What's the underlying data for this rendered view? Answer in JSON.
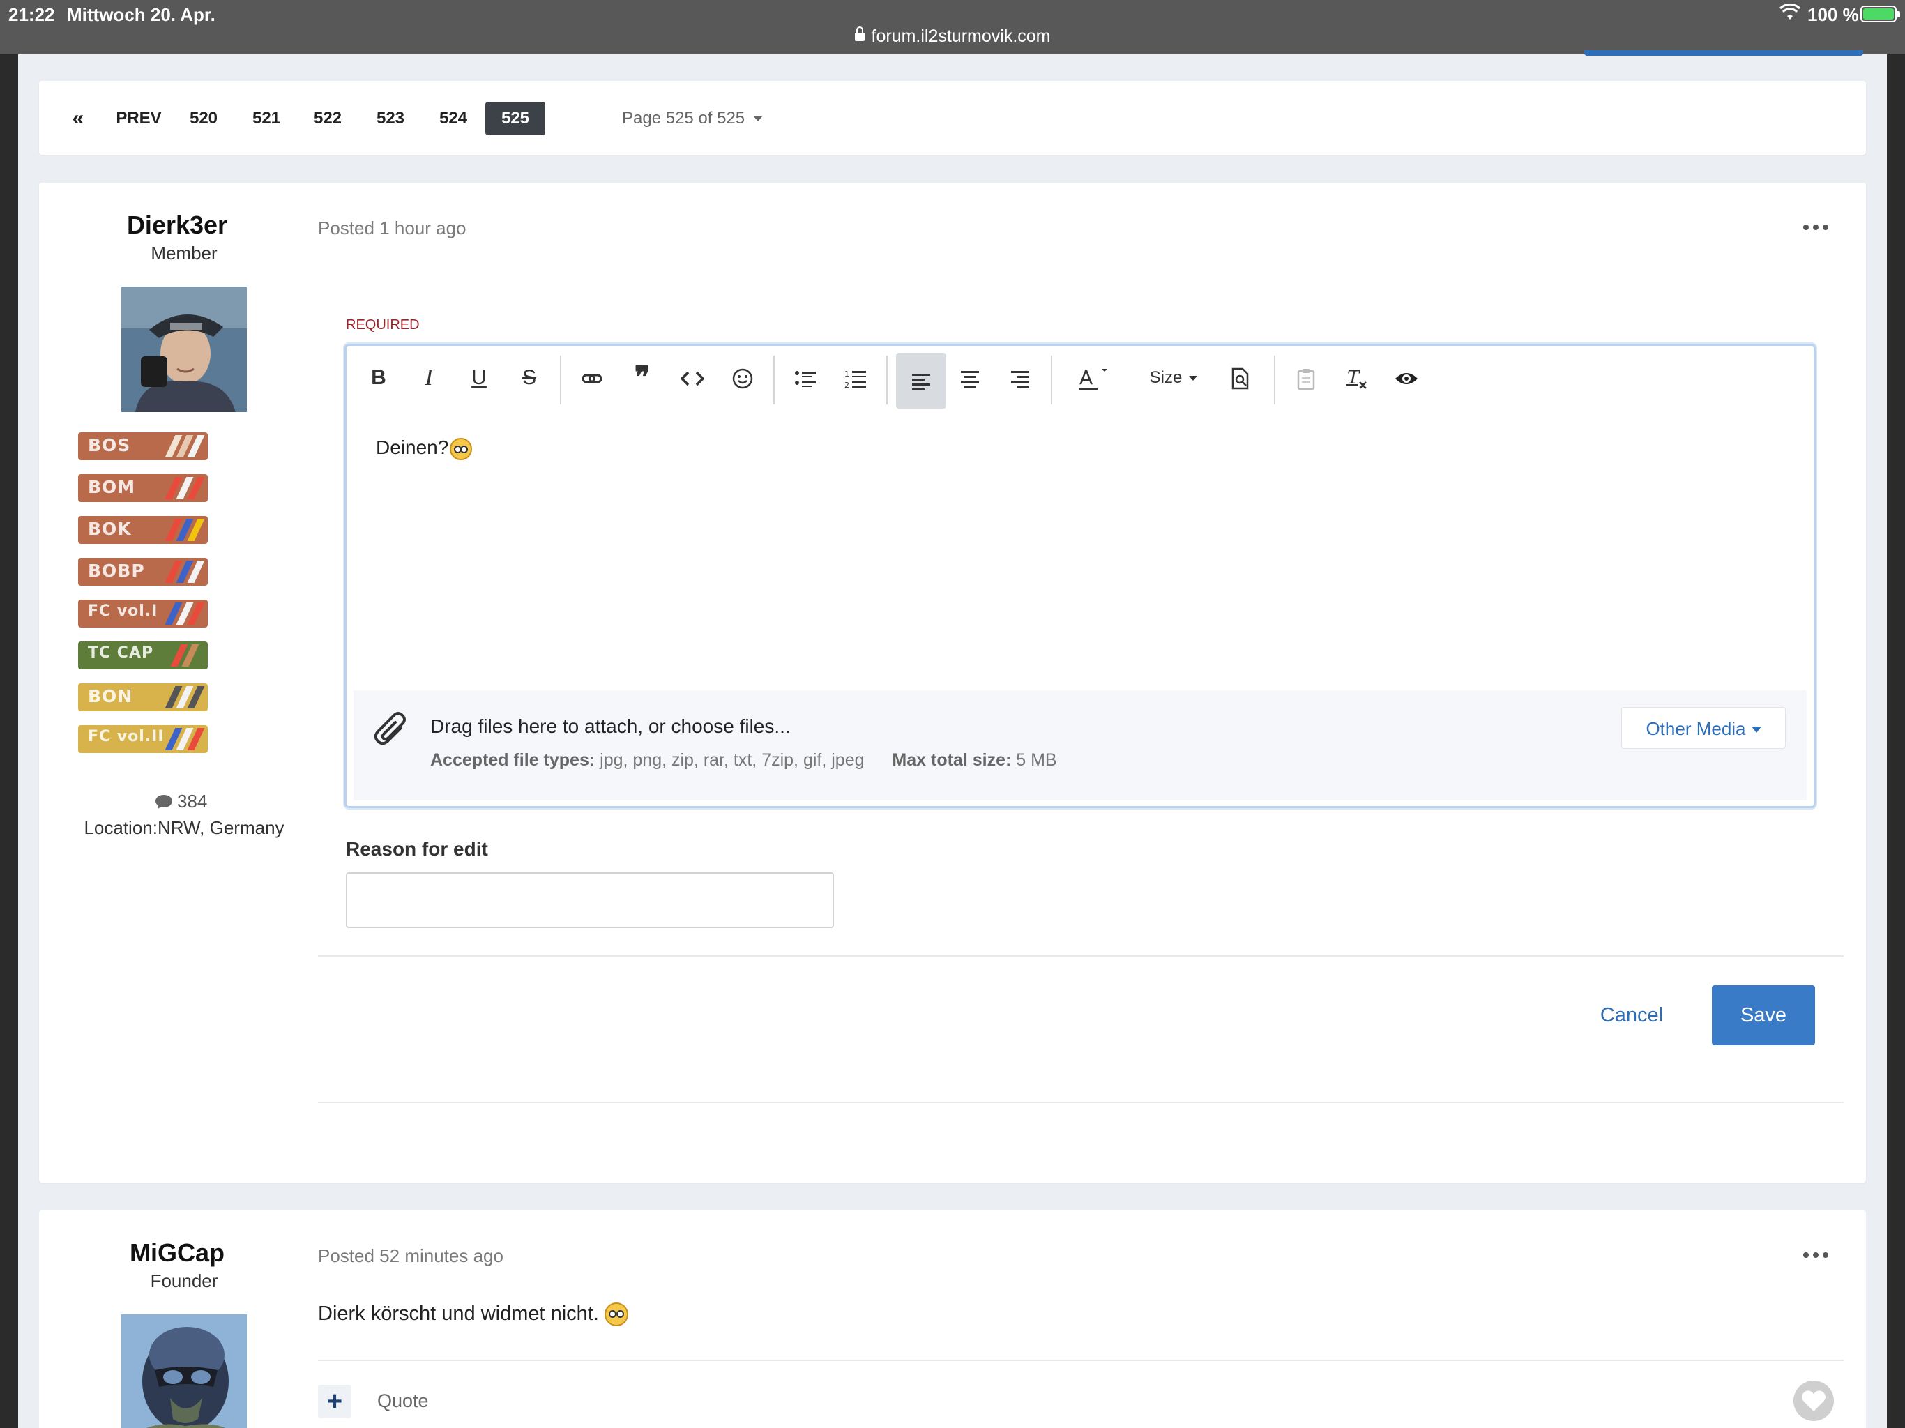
{
  "status_bar": {
    "time": "21:22",
    "date": "Mittwoch 20. Apr.",
    "url": "forum.il2sturmovik.com",
    "battery": "100 %"
  },
  "pagination": {
    "first_icon": "«",
    "prev": "PREV",
    "pages": [
      "520",
      "521",
      "522",
      "523",
      "524",
      "525"
    ],
    "active_page": "525",
    "page_info": "Page 525 of 525"
  },
  "post1": {
    "author": "Dierk3er",
    "role": "Member",
    "posted": "Posted 1 hour ago",
    "badges": [
      "BOS",
      "BOM",
      "BOK",
      "BOBP",
      "FC vol.I",
      "TC CAP",
      "BON",
      "FC vol.II"
    ],
    "post_count": "384",
    "location": "Location:NRW, Germany"
  },
  "editor": {
    "required_label": "REQUIRED",
    "toolbar": {
      "bold": "B",
      "italic": "I",
      "underline": "U",
      "strike": "S",
      "size": "Size"
    },
    "content": "Deinen?",
    "attach_main": "Drag files here to attach, or choose files...",
    "accepted_label": "Accepted file types:",
    "accepted_types": "jpg, png, zip, rar, txt, 7zip, gif, jpeg",
    "max_label": "Max total size:",
    "max_size": "5 MB",
    "other_media": "Other Media"
  },
  "reason": {
    "label": "Reason for edit",
    "value": ""
  },
  "actions": {
    "cancel": "Cancel",
    "save": "Save"
  },
  "post2": {
    "author": "MiGCap",
    "role": "Founder",
    "posted": "Posted 52 minutes ago",
    "body": "Dierk körscht und widmet nicht.",
    "quote": "Quote",
    "plus": "+"
  },
  "colors": {
    "accent": "#3a7bc8",
    "link": "#2e6db7",
    "required": "#a0232b",
    "active_page": "#3d4148"
  }
}
